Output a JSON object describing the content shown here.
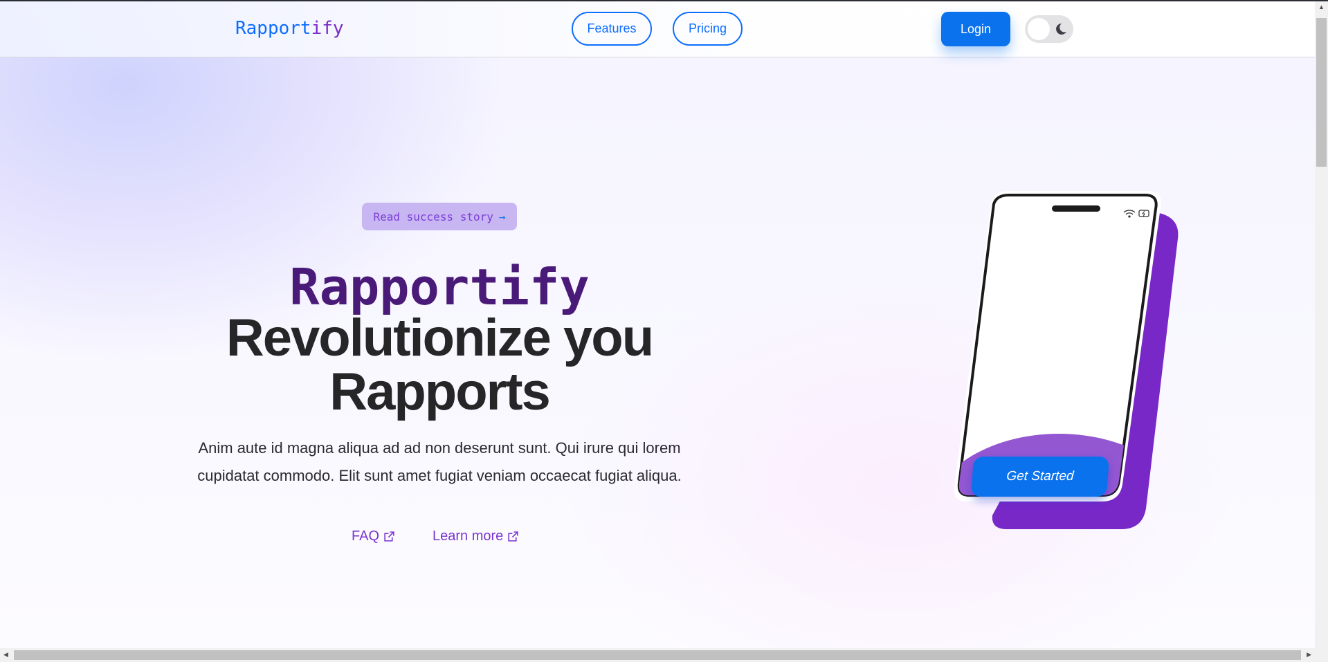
{
  "nav": {
    "logo_main": "Rapport",
    "logo_accent": "ify",
    "features": "Features",
    "pricing": "Pricing",
    "login": "Login",
    "theme_toggle_icon": "moon-icon"
  },
  "hero": {
    "badge": "Read success story",
    "badge_arrow": "→",
    "brand": "Rapportify",
    "headline_line1": "Revolutionize you",
    "headline_line2": "Rapports",
    "description": "Anim aute id magna aliqua ad ad non deserunt sunt. Qui irure qui lorem cupidatat commodo. Elit sunt amet fugiat veniam occaecat fugiat aliqua.",
    "links": [
      {
        "label": "FAQ",
        "icon": "external-link-icon"
      },
      {
        "label": "Learn more",
        "icon": "external-link-icon"
      }
    ]
  },
  "phone": {
    "cta": "Get Started",
    "status_icons": [
      "wifi-icon",
      "battery-charging-icon"
    ]
  },
  "colors": {
    "primary": "#0b72ee",
    "accent": "#7b2cc9",
    "brand_dark": "#4a1a78"
  }
}
